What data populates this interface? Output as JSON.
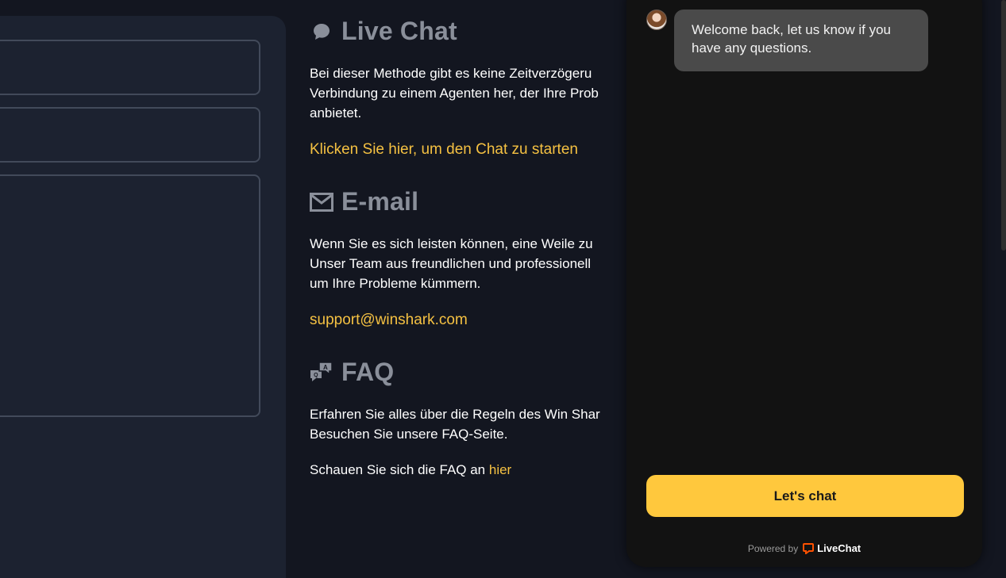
{
  "form": {
    "fields": [
      "",
      "",
      ""
    ]
  },
  "live_chat": {
    "title": "Live Chat",
    "icon": "speech-bubble-icon",
    "text_line1": "Bei dieser Methode gibt es keine Zeitverzögeru",
    "text_line2": "Verbindung zu einem Agenten her, der Ihre Prob",
    "text_line3": "anbietet.",
    "link": "Klicken Sie hier, um den Chat zu starten"
  },
  "email": {
    "title": "E-mail",
    "icon": "envelope-icon",
    "text_line1": "Wenn Sie es sich leisten können, eine Weile zu",
    "text_line2": "Unser Team aus freundlichen und professionell",
    "text_line3": "um Ihre Probleme kümmern.",
    "link": "support@winshark.com"
  },
  "faq": {
    "title": "FAQ",
    "icon": "qa-icon",
    "text_line1": "Erfahren Sie alles über die Regeln des Win Shar",
    "text_line2": "Besuchen Sie unsere FAQ-Seite.",
    "cta_prefix": "Schauen Sie sich die FAQ an",
    "cta_link": "hier"
  },
  "chat_widget": {
    "avatar": "agent-avatar",
    "message": "Welcome back, let us know if you have any questions.",
    "button_label": "Let's chat",
    "powered_by": "Powered by",
    "brand": "LiveChat",
    "colors": {
      "button": "#ffc83d",
      "bubble": "#4a4a4a",
      "brand_icon": "#ff5100"
    }
  },
  "colors": {
    "accent": "#f5c142",
    "background": "#131620"
  }
}
